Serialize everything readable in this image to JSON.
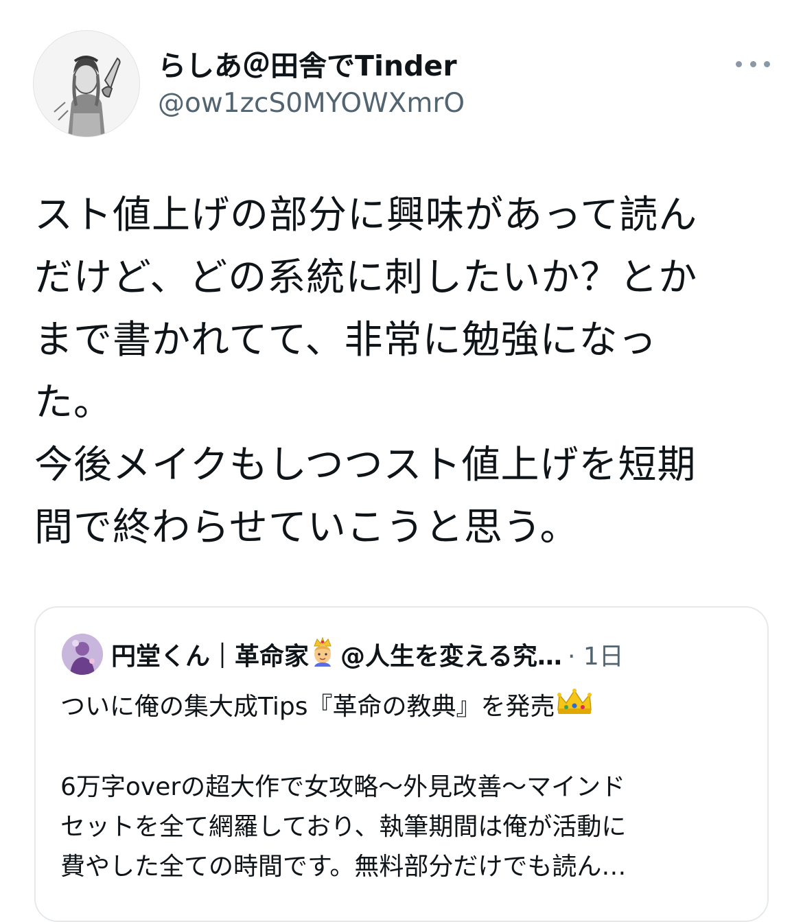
{
  "tweet": {
    "author_name": "らしあ＠田舎でTinder",
    "author_handle": "@ow1zcS0MYOWXmrO",
    "text_lines": [
      "スト値上げの部分に興味があって読ん",
      "だけど、どの系統に刺したいか？とか",
      "まで書かれてて、非常に勉強になっ",
      "た。",
      "今後メイクもしつつスト値上げを短期",
      "間で終わらせていこうと思う。"
    ],
    "more_icon": "more-horizontal-icon"
  },
  "quote": {
    "author_name": "円堂くん｜革命家",
    "author_suffix": "@人生を変える究…",
    "time": "· 1日",
    "line1": "ついに俺の集大成Tips『革命の教典』を発売",
    "body": "6万字overの超大作で女攻略〜外見改善〜マインドセットを全て網羅しており、執筆期間は俺が活動に費やした全ての時間です。無料部分だけでも読ん…",
    "body_lines": [
      "6万字overの超大作で女攻略〜外見改善〜マインド",
      "セットを全て網羅しており、執筆期間は俺が活動に",
      "費やした全ての時間です。無料部分だけでも読ん…"
    ],
    "emoji_prince": "prince-emoji",
    "emoji_crown": "crown-emoji"
  }
}
